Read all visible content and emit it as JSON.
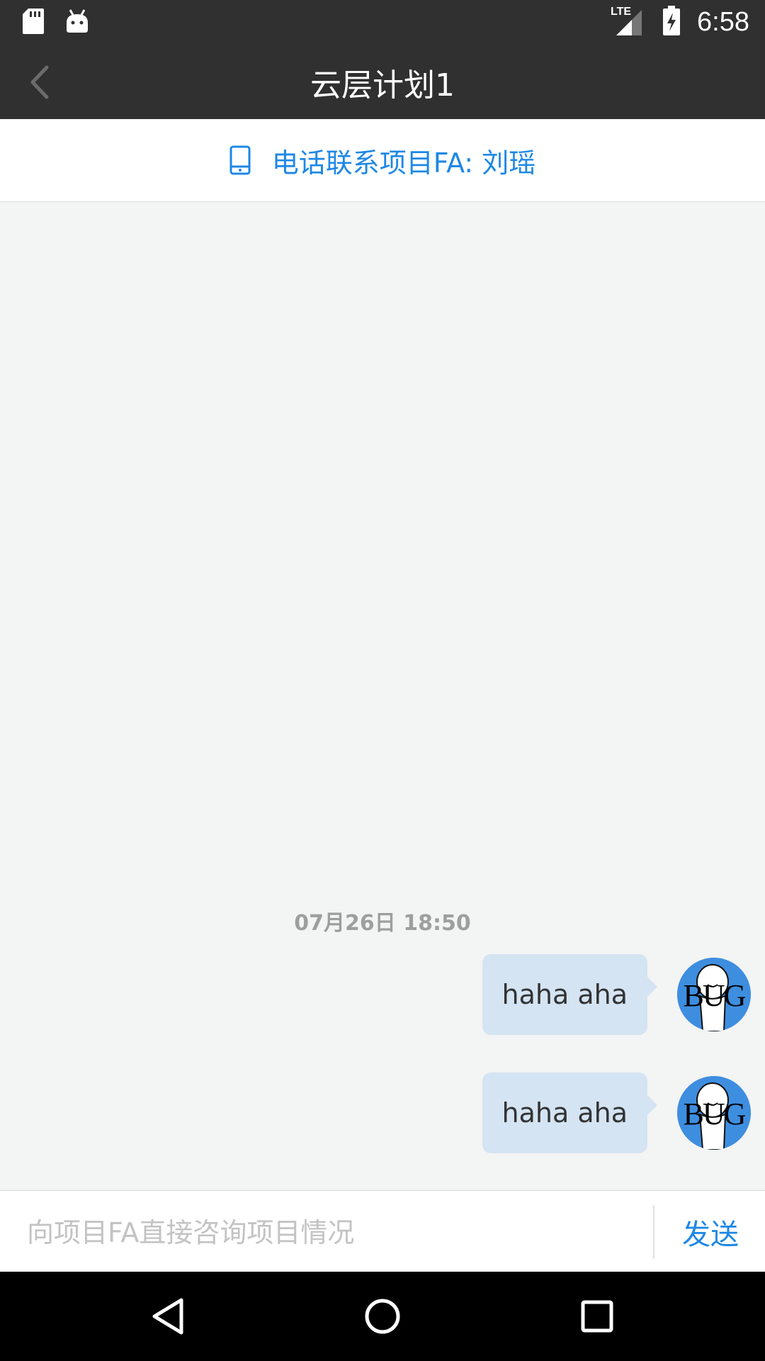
{
  "status_bar": {
    "time": "6:58",
    "network": "LTE",
    "icons": [
      "sd-card-icon",
      "android-icon",
      "signal-icon",
      "battery-charging-icon"
    ]
  },
  "app_bar": {
    "title": "云层计划1",
    "back_icon": "chevron-left-icon"
  },
  "contact": {
    "label": "电话联系项目FA: 刘瑶",
    "icon": "phone-icon"
  },
  "chat": {
    "timestamp": "07月26日 18:50",
    "messages": [
      {
        "text": "haha aha",
        "avatar_text": "BUG"
      },
      {
        "text": "haha aha",
        "avatar_text": "BUG"
      }
    ]
  },
  "input": {
    "placeholder": "向项目FA直接咨询项目情况",
    "value": "",
    "send_label": "发送"
  },
  "colors": {
    "accent": "#1e88e5",
    "bar": "#303030",
    "bubble": "#d4e4f3",
    "avatar": "#3e8ee0"
  }
}
